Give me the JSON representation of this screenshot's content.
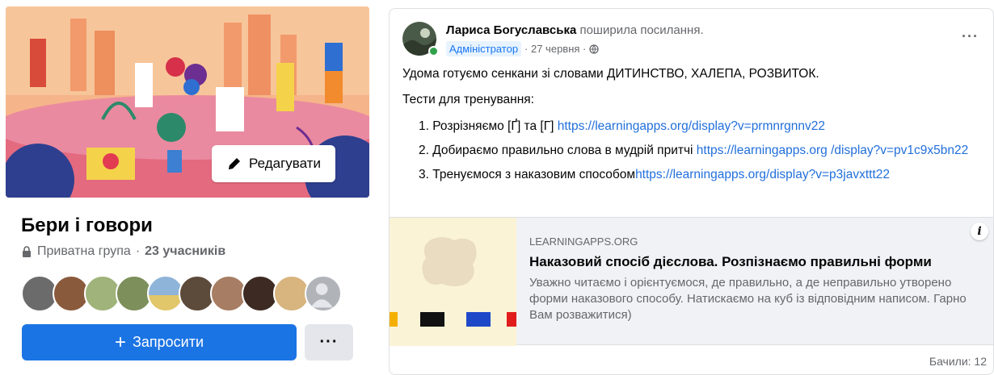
{
  "group": {
    "edit_label": "Редагувати",
    "title": "Бери і говори",
    "privacy": "Приватна група",
    "separator": "·",
    "members": "23 учасників",
    "invite_label": "Запросити",
    "more_label": "···",
    "avatar_colors": [
      "#6b6b6b",
      "#8a5a3c",
      "#9fb37a",
      "#7d8f5a",
      "#8fb4d9",
      "#5c4a3a",
      "#a77d63",
      "#3d2a22",
      "#d8b47e",
      "#b0b3b8"
    ]
  },
  "post": {
    "author": "Лариса Богуславська",
    "action": "поширила посилання.",
    "role": "Адміністратор",
    "date": "· 27 червня ·",
    "more_label": "···",
    "intro": "Удома готуємо сенкани зі словами ДИТИНСТВО, ХАЛЕПА, РОЗВИТОК.",
    "tests_heading": "Тести для тренування:",
    "tests": [
      {
        "text": "1. Розрізняємо [Ґ] та [Г] ",
        "link": "https://learningapps.org/display?v=prmnrgnnv22"
      },
      {
        "text": "2. Добираємо правильно слова в мудрій притчі ",
        "link": "https://learningapps.org /display?v=pv1c9x5bn22"
      },
      {
        "text": "3. Тренуємося з наказовим способом",
        "link": "https://learningapps.org/display?v=p3javxttt22"
      }
    ],
    "preview": {
      "domain": "LEARNINGAPPS.ORG",
      "title": "Наказовий спосіб дієслова. Розпізнаємо правильні форми",
      "description": "Уважно читаємо і орієнтуємося, де правильно, а де неправильно утворено форми наказового способу. Натискаємо на куб із відповідним написом. Гарно Вам розважитися)"
    },
    "views": "Бачили: 12"
  },
  "colors": {
    "accent": "#1b74e4",
    "link": "#216fdb",
    "online": "#31a24c"
  }
}
